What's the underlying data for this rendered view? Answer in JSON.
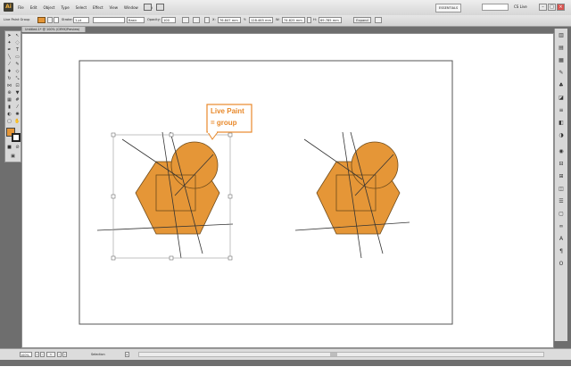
{
  "app": {
    "logo": "Ai",
    "menus": [
      "File",
      "Edit",
      "Object",
      "Type",
      "Select",
      "Effect",
      "View",
      "Window",
      "Help"
    ],
    "workspace": "ESSENTIALS",
    "cs_live": "CS Live",
    "window_buttons": [
      "–",
      "□",
      "×"
    ]
  },
  "control_bar": {
    "selection_label": "Live Paint Group",
    "stroke_label": "Stroke:",
    "stroke_value": "1 pt",
    "brush_label": "Basic",
    "opacity_label": "Opacity:",
    "opacity_value": "100",
    "x_label": "X:",
    "x_value": "76.847 mm",
    "y_label": "Y:",
    "y_value": "128.465 mm",
    "w_label": "W:",
    "w_value": "74.825 mm",
    "h_label": "H:",
    "h_value": "69.785 mm",
    "expand_button": "Expand",
    "fill_color": "#e59637"
  },
  "document": {
    "tab_title": "Untitled-1* @ 100% (CMYK/Preview)"
  },
  "canvas": {
    "callout_line1": "Live Paint",
    "callout_line2": "= group",
    "shape_fill": "#e59637",
    "callout_color": "#e8892b"
  },
  "status_bar": {
    "zoom": "100%",
    "page": "1",
    "status_text": "Selection"
  },
  "toolbox": {
    "tools": [
      "selection-tool",
      "direct-selection-tool",
      "magic-wand-tool",
      "lasso-tool",
      "pen-tool",
      "type-tool",
      "line-tool",
      "rectangle-tool",
      "paintbrush-tool",
      "pencil-tool",
      "blob-brush-tool",
      "eraser-tool",
      "rotate-tool",
      "scale-tool",
      "width-tool",
      "free-transform-tool",
      "shape-builder-tool",
      "live-paint-bucket-tool",
      "perspective-grid-tool",
      "mesh-tool",
      "gradient-tool",
      "eyedropper-tool",
      "blend-tool",
      "symbol-sprayer-tool",
      "column-graph-tool",
      "artboard-tool",
      "slice-tool",
      "hand-tool",
      "zoom-tool"
    ]
  }
}
